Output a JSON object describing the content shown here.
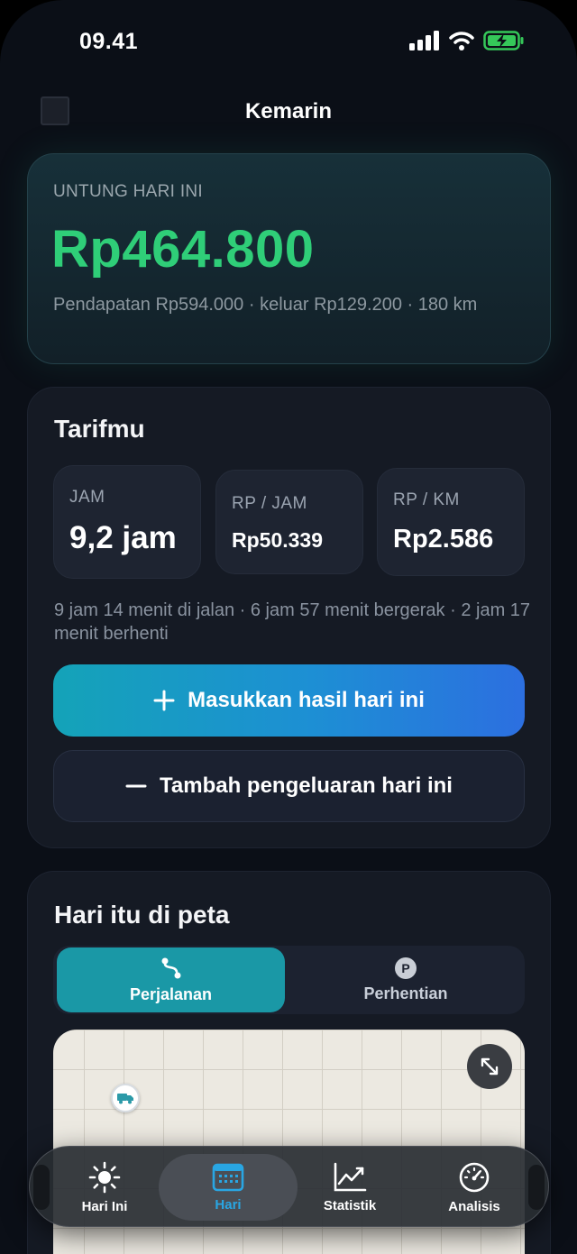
{
  "status": {
    "time": "09.41"
  },
  "nav": {
    "title": "Kemarin"
  },
  "profit": {
    "label": "UNTUNG HARI INI",
    "value": "Rp464.800",
    "sub": "Pendapatan Rp594.000 · keluar Rp129.200 · 180 km"
  },
  "tariff": {
    "title": "Tarifmu",
    "metrics": [
      {
        "label": "JAM",
        "value": "9,2 jam"
      },
      {
        "label": "RP / JAM",
        "value": "Rp50.339"
      },
      {
        "label": "RP / KM",
        "value": "Rp2.586"
      }
    ],
    "sub": "9 jam 14 menit di jalan · 6 jam 57 menit bergerak · 2 jam 17 menit berhenti",
    "primary_button": "Masukkan hasil hari ini",
    "secondary_button": "Tambah pengeluaran hari ini"
  },
  "map_section": {
    "title": "Hari itu di peta",
    "segments": [
      {
        "label": "Perjalanan",
        "icon": "route-icon",
        "active": true
      },
      {
        "label": "Perhentian",
        "icon": "parking-icon",
        "active": false
      }
    ],
    "parking_glyph": "P"
  },
  "tabbar": {
    "items": [
      {
        "label": "Hari Ini",
        "icon": "sun-icon"
      },
      {
        "label": "Hari",
        "icon": "calendar-icon",
        "active": true
      },
      {
        "label": "Statistik",
        "icon": "chart-icon"
      },
      {
        "label": "Analisis",
        "icon": "gauge-icon"
      }
    ]
  },
  "colors": {
    "profit": "#2fce78",
    "accent": "#1a98a6",
    "tab_active": "#29a6e3"
  }
}
